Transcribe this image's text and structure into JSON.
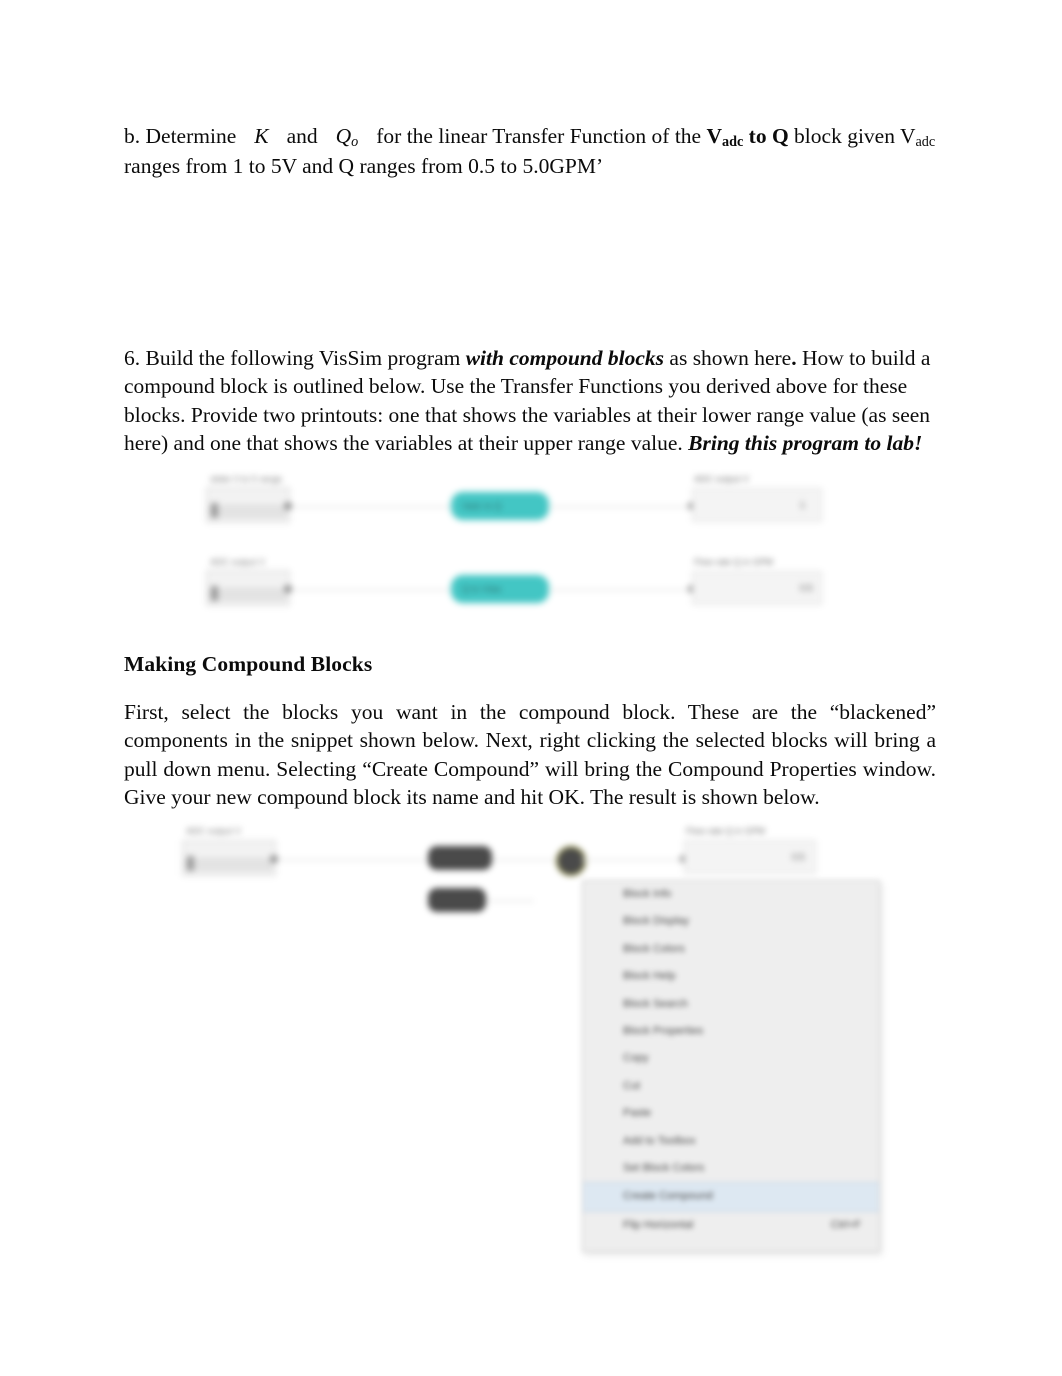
{
  "document": {
    "background_color": "#ffffff",
    "text_color": "#0b0b0b"
  },
  "question_b": {
    "prefix": "b.  Determine",
    "symbol_k": "K",
    "conjunction": "and",
    "symbol_qo": "Q",
    "symbol_qo_sub": "o",
    "mid": "for the linear Transfer Function of the",
    "block_name_prefix": "V",
    "block_name_sub": "adc",
    "block_name_mid": " to Q",
    "after_block": "block given V",
    "after_block_sub": "adc",
    "line2": "ranges from 1 to 5V and Q ranges from 0.5 to 5.0GPM’"
  },
  "question_6": {
    "lead": "6.  Build the following VisSim program ",
    "emphasis1": "with compound blocks",
    "body": " as shown here",
    "body_bold_period": ".",
    "body2": "  How to build a compound block is outlined below.  Use the Transfer Functions you derived above for these blocks.  Provide two printouts:  one that shows the variables at their lower range value (as seen here) and one that shows the variables at their upper range value.  ",
    "emphasis2": "Bring this program to lab!"
  },
  "making_compound_blocks": {
    "heading": "Making Compound Blocks",
    "paragraph": "First, select the blocks you want in the compound block.  These are the “blackened” components in the snippet shown below.  Next, right clicking the selected blocks will bring a pull down menu.  Selecting “Create Compound” will bring the Compound Properties window.  Give your new compound block its name and hit OK.  The result is shown below."
  },
  "vissim_diagram_top": {
    "accent_color": "#43c6c4",
    "rows": [
      {
        "source_label": "slider 0 to 5 range",
        "source_value": "1.000000",
        "compound_label": "Vadc to Q",
        "display_label": "ADC output V",
        "display_value": "1"
      },
      {
        "source_label": "ADC output V",
        "source_value": "1.000000",
        "compound_label": "Q to Vdac",
        "display_label": "Flow rate Q in GPM",
        "display_value": "0.5"
      }
    ]
  },
  "vissim_diagram_bottom": {
    "source_label": "ADC output V",
    "source_value": "1.000000",
    "display_label": "Flow rate Q in GPM",
    "display_value": "0.5",
    "selected_block_count": 3
  },
  "context_menu": {
    "items": [
      {
        "label": "Block Info",
        "shortcut": "",
        "highlighted": false
      },
      {
        "label": "Block Display",
        "shortcut": "",
        "highlighted": false
      },
      {
        "label": "Block Colors",
        "shortcut": "",
        "highlighted": false
      },
      {
        "label": "Block Help",
        "shortcut": "",
        "highlighted": false
      },
      {
        "label": "Block Search",
        "shortcut": "",
        "highlighted": false
      },
      {
        "label": "Block Properties",
        "shortcut": "",
        "highlighted": false
      },
      {
        "label": "Copy",
        "shortcut": "",
        "highlighted": false
      },
      {
        "label": "Cut",
        "shortcut": "",
        "highlighted": false
      },
      {
        "label": "Paste",
        "shortcut": "",
        "highlighted": false
      },
      {
        "label": "Add to Toolbox",
        "shortcut": "",
        "highlighted": false
      },
      {
        "label": "Set Block Colors",
        "shortcut": "",
        "highlighted": false
      },
      {
        "label": "Create Compound",
        "shortcut": "",
        "highlighted": true
      },
      {
        "label": "Flip Horizontal",
        "shortcut": "Ctrl+F",
        "highlighted": false
      }
    ]
  }
}
